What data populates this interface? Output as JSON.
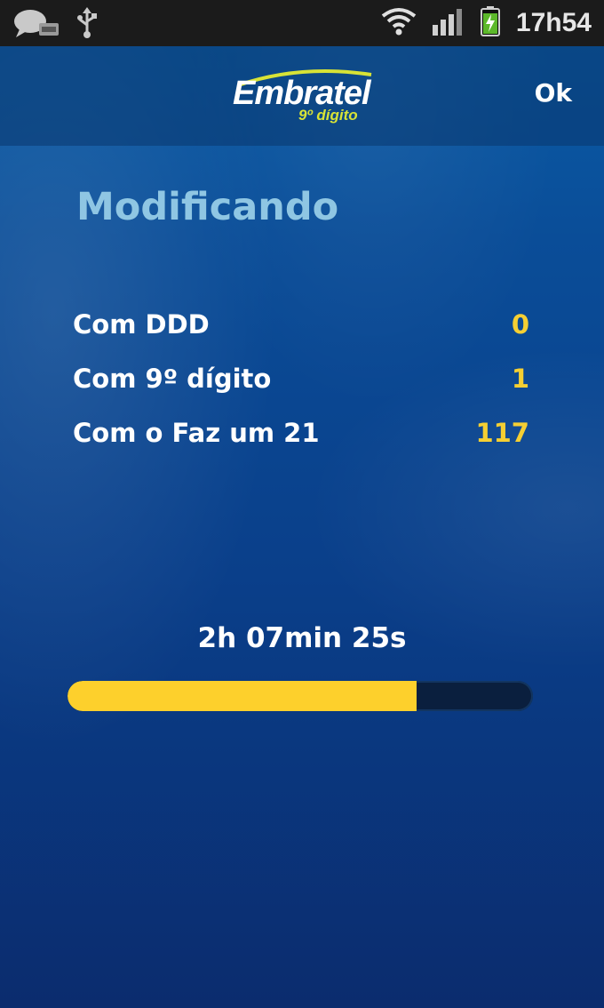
{
  "status_bar": {
    "time": "17h54",
    "icons": [
      "chat-icon",
      "usb-icon",
      "wifi-icon",
      "signal-icon",
      "battery-charging-icon"
    ]
  },
  "header": {
    "logo_text": "Embratel",
    "logo_subtext": "9º dígito",
    "ok_label": "Ok"
  },
  "main": {
    "title": "Modificando",
    "stats": [
      {
        "label": "Com DDD",
        "value": "0"
      },
      {
        "label": "Com 9º dígito",
        "value": "1"
      },
      {
        "label": "Com o Faz um 21",
        "value": "117"
      }
    ],
    "timer": "2h 07min 25s",
    "progress_fraction": 0.75
  },
  "colors": {
    "accent_yellow": "#fdd02c",
    "title_blue": "#8fc6e3",
    "background_blue": "#0a4d98"
  }
}
